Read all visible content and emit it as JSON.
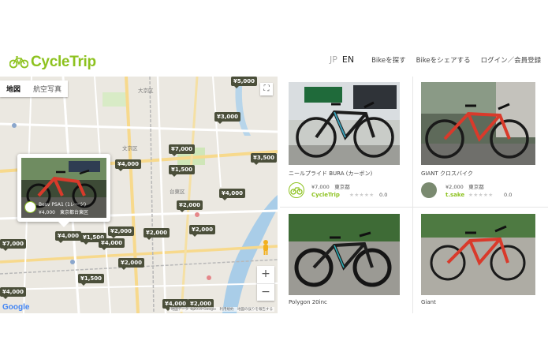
{
  "header": {
    "logo_text": "CycleTrip",
    "lang_jp": "JP",
    "lang_en": "EN",
    "nav": [
      "Bikeを探す",
      "Bikeをシェアする",
      "ログイン／会員登録"
    ]
  },
  "map": {
    "type_map": "地図",
    "type_satellite": "航空写真",
    "google": "Google",
    "attribution": "地図データ ©2019 Google　利用規約　地図の誤りを報告する",
    "zoom_in": "+",
    "zoom_out": "−",
    "labels": {
      "area1": "大京区",
      "area2": "台東区",
      "area3": "文京区"
    },
    "prices": [
      "¥5,000",
      "¥3,000",
      "¥7,000",
      "¥3,500",
      "¥4,000",
      "¥2,000",
      "¥4,000",
      "¥1,500",
      "¥2,000",
      "¥2,000",
      "¥4,000",
      "¥1,500",
      "¥2,000",
      "¥4,000",
      "¥7,000",
      "¥4,000",
      "¥2,000",
      "¥1,500",
      "¥4,000",
      "¥2,000"
    ],
    "popup": {
      "title": "Besv PSA1 (1レーツ)",
      "meta": "¥4,000　東京都台東区"
    }
  },
  "listings": [
    {
      "title": "ニールプライド BURA (カーボン)",
      "price": "¥7,000",
      "location": "東京都",
      "owner": "CycleTrip",
      "stars": "★★★★★",
      "rating": "0.0"
    },
    {
      "title": "GIANT クロスバイク",
      "price": "¥2,000",
      "location": "東京都",
      "owner": "t.sake",
      "stars": "★★★★★",
      "rating": "0.0"
    },
    {
      "title": "Polygon 20inc"
    },
    {
      "title": "Giant"
    }
  ],
  "colors": {
    "brand": "#8dc21f",
    "marker": "#4b4f3a",
    "bike_red": "#d93a2b"
  }
}
